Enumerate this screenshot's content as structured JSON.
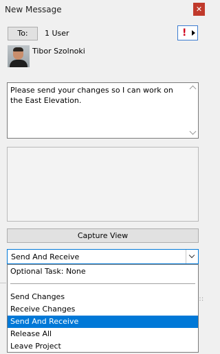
{
  "window": {
    "title": "New Message",
    "close_icon": "close-icon"
  },
  "recipients": {
    "to_button": "To:",
    "count": "1 User",
    "priority_icon": "exclamation-icon",
    "priority_color": "#d0021b"
  },
  "user": {
    "name": "Tibor Szolnoki"
  },
  "message": {
    "body": "Please send your changes so I can work on the East Elevation."
  },
  "capture_button": "Capture View",
  "task": {
    "selected": "Send And Receive",
    "options": [
      {
        "label": "Optional Task: None",
        "selected": false
      },
      {
        "label": "Send Changes",
        "selected": false
      },
      {
        "label": "Receive Changes",
        "selected": false
      },
      {
        "label": "Send And Receive",
        "selected": true
      },
      {
        "label": "Release All",
        "selected": false
      },
      {
        "label": "Leave Project",
        "selected": false
      }
    ]
  },
  "colors": {
    "accent": "#0078d7",
    "close": "#c0392b"
  }
}
